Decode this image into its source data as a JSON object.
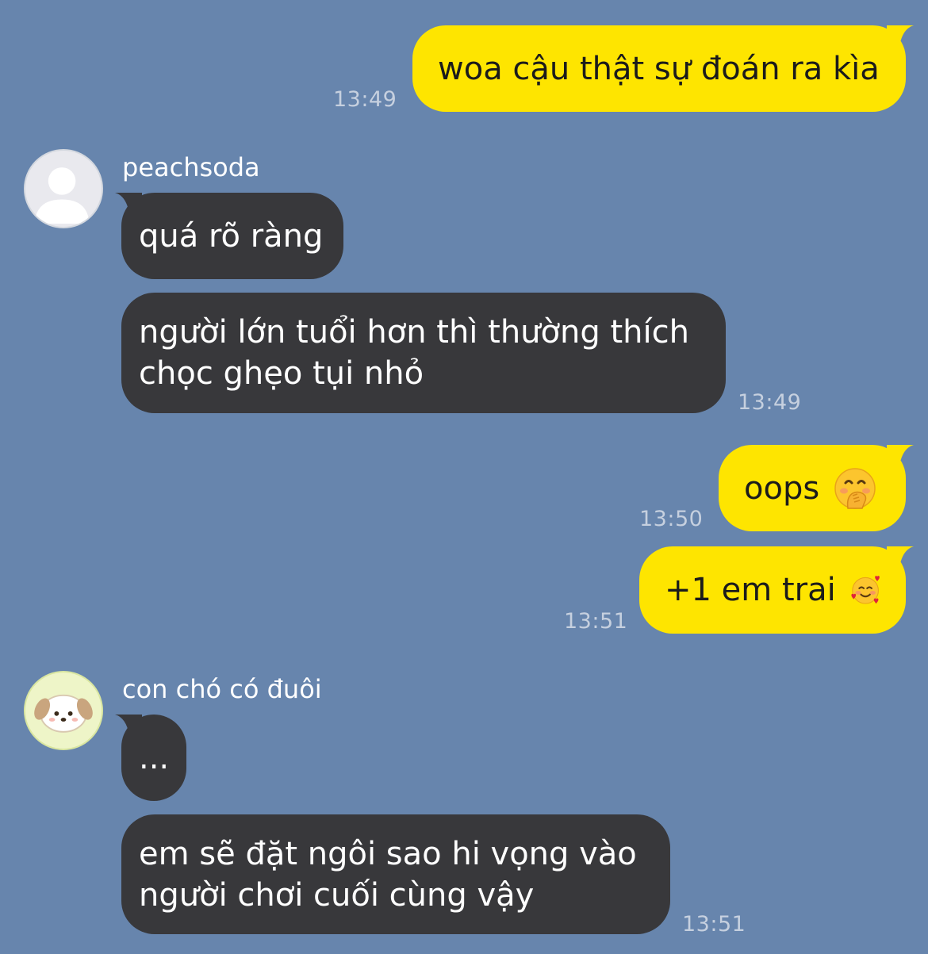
{
  "messages": [
    {
      "id": "m1",
      "side": "out",
      "text": "woa cậu thật sự đoán ra kìa",
      "time": "13:49"
    },
    {
      "id": "m2",
      "side": "in",
      "sender": "peachsoda",
      "text": "quá rõ ràng"
    },
    {
      "id": "m3",
      "side": "in",
      "lines": [
        "người lớn tuổi hơn thì thường thích",
        "chọc ghẹo tụi nhỏ"
      ],
      "time": "13:49"
    },
    {
      "id": "m4",
      "side": "out",
      "text": "oops",
      "emoji": "hand-over-mouth-emoji",
      "time": "13:50"
    },
    {
      "id": "m5",
      "side": "out",
      "text": "+1 em trai",
      "emoji": "smiling-face-with-hearts-emoji",
      "time": "13:51"
    },
    {
      "id": "m6",
      "side": "in",
      "sender": "con chó có đuôi",
      "text": "..."
    },
    {
      "id": "m7",
      "side": "in",
      "lines": [
        "em sẽ đặt ngôi sao hi vọng vào",
        "người chơi cuối cùng vậy"
      ],
      "time": "13:51"
    }
  ],
  "colors": {
    "background": "#6785ad",
    "outgoing_bubble": "#fee500",
    "incoming_bubble": "#38383b",
    "timestamp": "#c6d0df"
  },
  "avatars": {
    "peachsoda": "default-user-avatar-icon",
    "con_cho_co_duoi": "puppy-avatar-icon"
  }
}
